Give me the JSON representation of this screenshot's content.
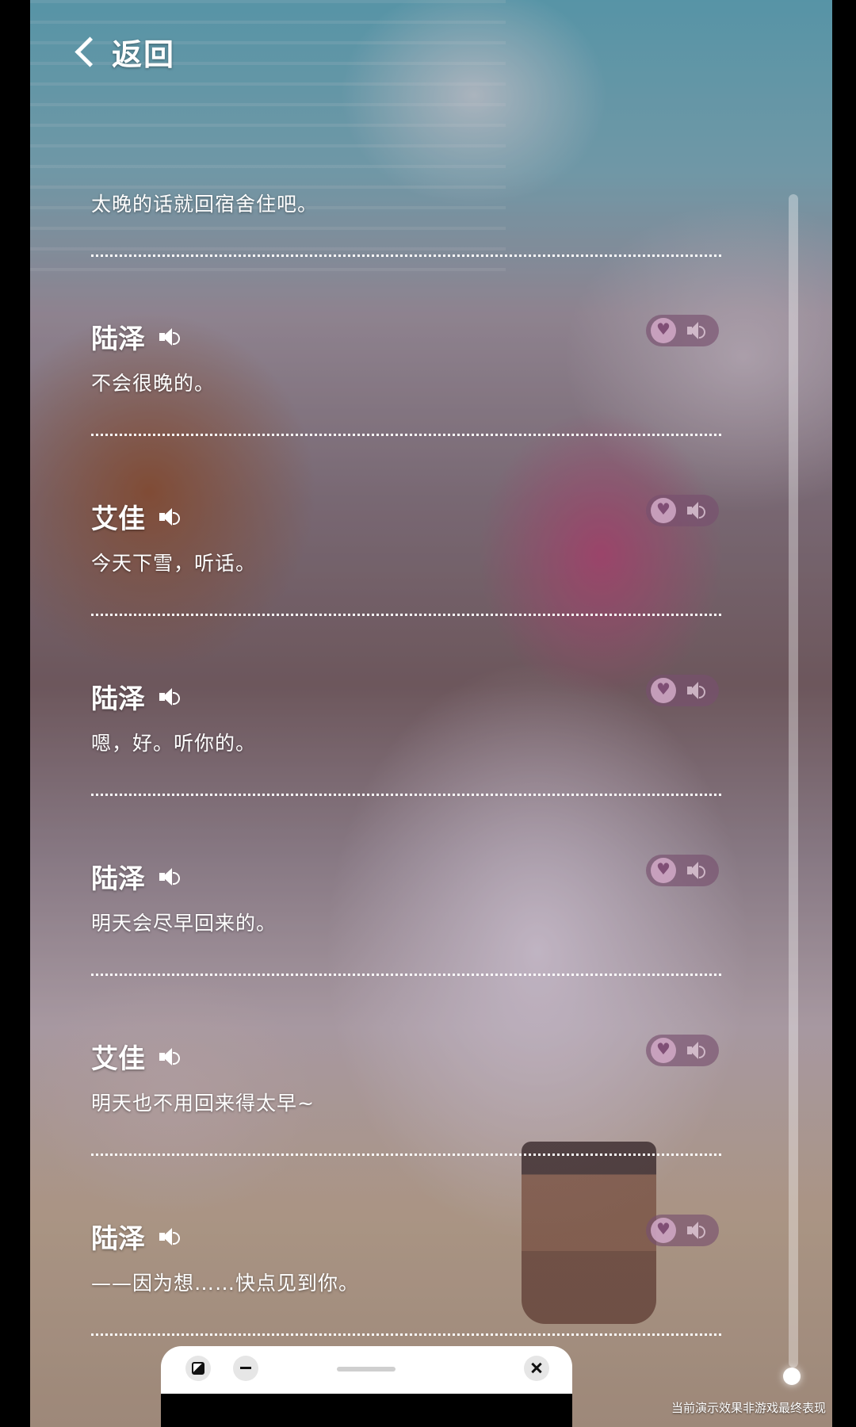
{
  "nav": {
    "back_label": "返回"
  },
  "entries": [
    {
      "speaker": "",
      "text": "太晚的话就回宿舍住吧。"
    },
    {
      "speaker": "陆泽",
      "text": "不会很晚的。"
    },
    {
      "speaker": "艾佳",
      "text": "今天下雪，听话。"
    },
    {
      "speaker": "陆泽",
      "text": "嗯，好。听你的。"
    },
    {
      "speaker": "陆泽",
      "text": "明天会尽早回来的。"
    },
    {
      "speaker": "艾佳",
      "text": "明天也不用回来得太早~"
    },
    {
      "speaker": "陆泽",
      "text": "——因为想……快点见到你。"
    }
  ],
  "icons": {
    "back": "chevron-left-icon",
    "voice": "speaker-icon",
    "favorite": "heart-icon",
    "replay": "volume-icon",
    "theme": "contrast-icon",
    "minimize": "minus-icon",
    "close": "close-icon"
  },
  "footer": {
    "disclaimer": "当前演示效果非游戏最终表现"
  },
  "colors": {
    "pill": "#7a5070",
    "heart": "#d2aac8",
    "divider": "#ffffff"
  }
}
